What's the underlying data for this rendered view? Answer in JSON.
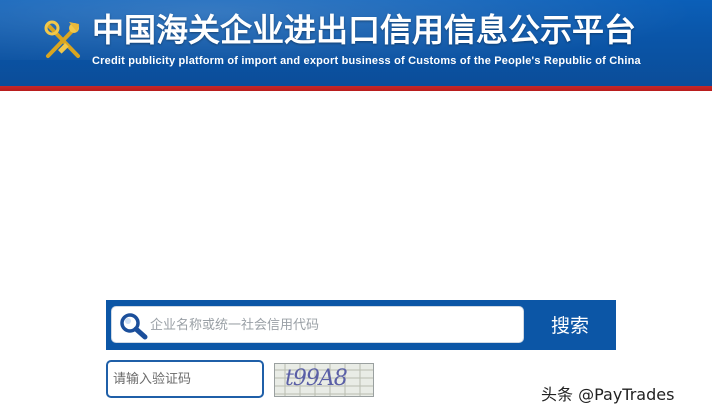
{
  "header": {
    "title": "中国海关企业进出口信用信息公示平台",
    "subtitle": "Credit publicity platform of import and export business of Customs of the People's Republic of China",
    "emblem_icon": "customs-emblem-icon"
  },
  "search": {
    "placeholder": "企业名称或统一社会信用代码",
    "value": "",
    "button_label": "搜索",
    "icon": "search-icon"
  },
  "captcha": {
    "placeholder": "请输入验证码",
    "value": "",
    "image_text": "t99A8"
  },
  "watermark": {
    "text": "头条 @PayTrades"
  },
  "colors": {
    "header_blue": "#0b5fb8",
    "header_stripe": "#c62828",
    "search_bar_blue": "#0c56a6",
    "captcha_border": "#1f5fa8"
  }
}
